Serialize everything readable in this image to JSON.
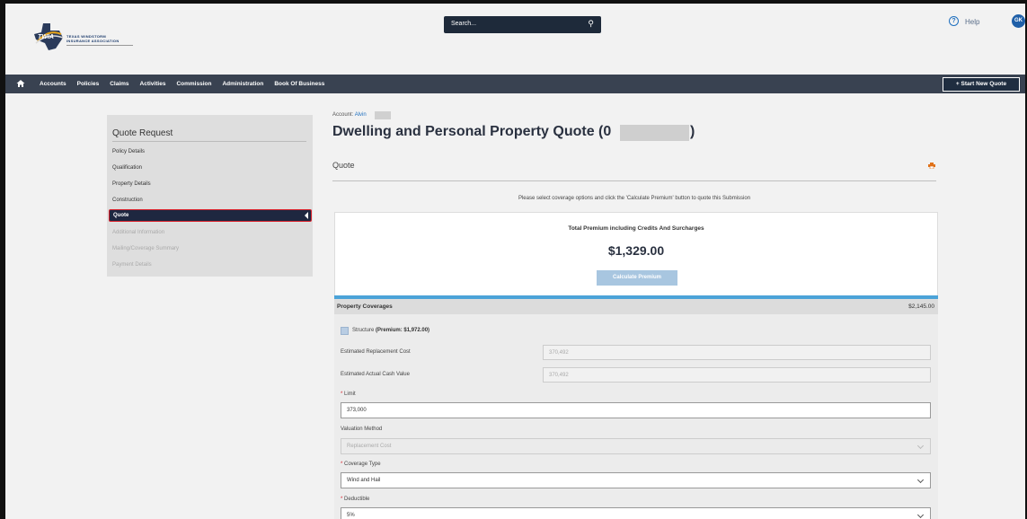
{
  "header": {
    "logo_text": "TWIA",
    "logo_sub_line1": "TEXAS WINDSTORM",
    "logo_sub_line2": "INSURANCE ASSOCIATION",
    "search_placeholder": "Search...",
    "help_label": "Help",
    "avatar_initials": "GK"
  },
  "nav": {
    "items": [
      "Accounts",
      "Policies",
      "Claims",
      "Activities",
      "Commission",
      "Administration",
      "Book Of Business"
    ],
    "start_quote_label": "+ Start New Quote"
  },
  "sidebar": {
    "title": "Quote Request",
    "items": [
      {
        "label": "Policy Details",
        "state": "enabled"
      },
      {
        "label": "Qualification",
        "state": "enabled"
      },
      {
        "label": "Property Details",
        "state": "enabled"
      },
      {
        "label": "Construction",
        "state": "enabled"
      },
      {
        "label": "Quote",
        "state": "active"
      },
      {
        "label": "Additional Information",
        "state": "disabled"
      },
      {
        "label": "Mailing/Coverage Summary",
        "state": "disabled"
      },
      {
        "label": "Payment Details",
        "state": "disabled"
      }
    ]
  },
  "main": {
    "account_label": "Account:",
    "account_name": "Alvin",
    "title": "Dwelling and Personal Property Quote (0",
    "title_close": ")",
    "section": "Quote",
    "instructions": "Please select coverage options and click the 'Calculate Premium' button to quote this Submission",
    "premium_title": "Total Premium including Credits And Surcharges",
    "premium_value": "$1,329.00",
    "calculate_label": "Calculate Premium"
  },
  "coverage": {
    "title": "Property Coverages",
    "amount": "$2,145.00",
    "structure_label": "Structure",
    "structure_premium": "(Premium: $1,972.00)",
    "est_replacement_label": "Estimated Replacement Cost",
    "est_replacement_value": "370,492",
    "est_acv_label": "Estimated Actual Cash Value",
    "est_acv_value": "370,492",
    "limit_label": "Limit",
    "limit_value": "373,000",
    "valuation_label": "Valuation Method",
    "valuation_value": "Replacement Cost",
    "coverage_type_label": "Coverage Type",
    "coverage_type_value": "Wind and Hail",
    "deductible_label": "Deductible",
    "deductible_value": "5%",
    "required_mark": "*"
  },
  "colors": {
    "nav_bg": "#394251",
    "active_bg": "#1e2740",
    "highlight": "#d9202a",
    "accent_blue": "#4ba3d8"
  }
}
